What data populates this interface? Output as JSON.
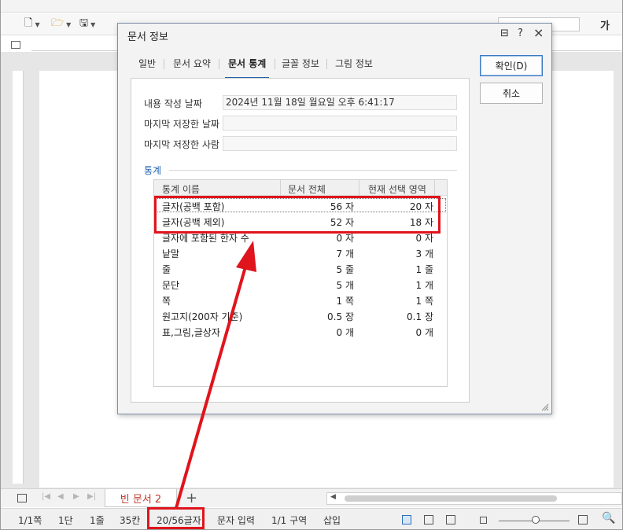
{
  "toolbar": {
    "icons": [
      "new-document-icon",
      "open-folder-icon",
      "save-icon"
    ],
    "bold_label": "가"
  },
  "dialog": {
    "title": "문서 정보",
    "controls": {
      "help_icon": "?",
      "close_icon": "×",
      "info_icon": "⊟"
    },
    "tabs": [
      {
        "label": "일반"
      },
      {
        "label": "문서 요약"
      },
      {
        "label": "문서 통계"
      },
      {
        "label": "글꼴 정보"
      },
      {
        "label": "그림 정보"
      }
    ],
    "buttons": {
      "ok": "확인(D)",
      "cancel": "취소"
    },
    "fields": [
      {
        "label": "내용 작성 날짜",
        "value": "2024년 11월 18일 월요일 오후 6:41:17"
      },
      {
        "label": "마지막 저장한 날짜",
        "value": ""
      },
      {
        "label": "마지막 저장한 사람",
        "value": ""
      }
    ],
    "section": "통계",
    "table": {
      "headers": [
        "통계 이름",
        "문서 전체",
        "현재 선택 영역"
      ],
      "rows": [
        {
          "name": "글자(공백 포함)",
          "total": "56 자",
          "selected": "20 자"
        },
        {
          "name": "글자(공백 제외)",
          "total": "52 자",
          "selected": "18 자"
        },
        {
          "name": "글자에 포함된 한자 수",
          "total": "0 자",
          "selected": "0 자"
        },
        {
          "name": "낱말",
          "total": "7 개",
          "selected": "3 개"
        },
        {
          "name": "줄",
          "total": "5 줄",
          "selected": "1 줄"
        },
        {
          "name": "문단",
          "total": "5 개",
          "selected": "1 개"
        },
        {
          "name": "쪽",
          "total": "1 쪽",
          "selected": "1 쪽"
        },
        {
          "name": "원고지(200자 기준)",
          "total": "0.5 장",
          "selected": "0.1 장"
        },
        {
          "name": "표,그림,글상자",
          "total": "0 개",
          "selected": "0 개"
        }
      ]
    }
  },
  "sheet_tabs": {
    "doc_tab": "빈 문서 2",
    "add": "+"
  },
  "statusbar": {
    "items": [
      "1/1쪽",
      "1단",
      "1줄",
      "35칸",
      "20/56글자",
      "문자 입력",
      "1/1 구역",
      "삽입"
    ]
  },
  "annotation": {
    "color": "#e0141c"
  }
}
